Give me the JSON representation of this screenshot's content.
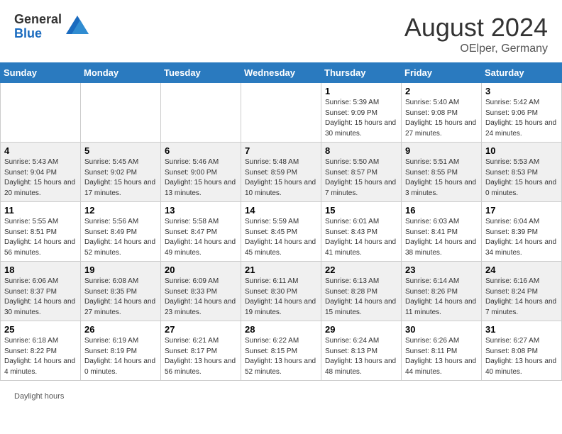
{
  "header": {
    "logo_general": "General",
    "logo_blue": "Blue",
    "month_year": "August 2024",
    "location": "OElper, Germany"
  },
  "days_of_week": [
    "Sunday",
    "Monday",
    "Tuesday",
    "Wednesday",
    "Thursday",
    "Friday",
    "Saturday"
  ],
  "weeks": [
    [
      {
        "day": "",
        "empty": true
      },
      {
        "day": "",
        "empty": true
      },
      {
        "day": "",
        "empty": true
      },
      {
        "day": "",
        "empty": true
      },
      {
        "day": "1",
        "sunrise": "5:39 AM",
        "sunset": "9:09 PM",
        "daylight": "15 hours and 30 minutes."
      },
      {
        "day": "2",
        "sunrise": "5:40 AM",
        "sunset": "9:08 PM",
        "daylight": "15 hours and 27 minutes."
      },
      {
        "day": "3",
        "sunrise": "5:42 AM",
        "sunset": "9:06 PM",
        "daylight": "15 hours and 24 minutes."
      }
    ],
    [
      {
        "day": "4",
        "sunrise": "5:43 AM",
        "sunset": "9:04 PM",
        "daylight": "15 hours and 20 minutes."
      },
      {
        "day": "5",
        "sunrise": "5:45 AM",
        "sunset": "9:02 PM",
        "daylight": "15 hours and 17 minutes."
      },
      {
        "day": "6",
        "sunrise": "5:46 AM",
        "sunset": "9:00 PM",
        "daylight": "15 hours and 13 minutes."
      },
      {
        "day": "7",
        "sunrise": "5:48 AM",
        "sunset": "8:59 PM",
        "daylight": "15 hours and 10 minutes."
      },
      {
        "day": "8",
        "sunrise": "5:50 AM",
        "sunset": "8:57 PM",
        "daylight": "15 hours and 7 minutes."
      },
      {
        "day": "9",
        "sunrise": "5:51 AM",
        "sunset": "8:55 PM",
        "daylight": "15 hours and 3 minutes."
      },
      {
        "day": "10",
        "sunrise": "5:53 AM",
        "sunset": "8:53 PM",
        "daylight": "15 hours and 0 minutes."
      }
    ],
    [
      {
        "day": "11",
        "sunrise": "5:55 AM",
        "sunset": "8:51 PM",
        "daylight": "14 hours and 56 minutes."
      },
      {
        "day": "12",
        "sunrise": "5:56 AM",
        "sunset": "8:49 PM",
        "daylight": "14 hours and 52 minutes."
      },
      {
        "day": "13",
        "sunrise": "5:58 AM",
        "sunset": "8:47 PM",
        "daylight": "14 hours and 49 minutes."
      },
      {
        "day": "14",
        "sunrise": "5:59 AM",
        "sunset": "8:45 PM",
        "daylight": "14 hours and 45 minutes."
      },
      {
        "day": "15",
        "sunrise": "6:01 AM",
        "sunset": "8:43 PM",
        "daylight": "14 hours and 41 minutes."
      },
      {
        "day": "16",
        "sunrise": "6:03 AM",
        "sunset": "8:41 PM",
        "daylight": "14 hours and 38 minutes."
      },
      {
        "day": "17",
        "sunrise": "6:04 AM",
        "sunset": "8:39 PM",
        "daylight": "14 hours and 34 minutes."
      }
    ],
    [
      {
        "day": "18",
        "sunrise": "6:06 AM",
        "sunset": "8:37 PM",
        "daylight": "14 hours and 30 minutes."
      },
      {
        "day": "19",
        "sunrise": "6:08 AM",
        "sunset": "8:35 PM",
        "daylight": "14 hours and 27 minutes."
      },
      {
        "day": "20",
        "sunrise": "6:09 AM",
        "sunset": "8:33 PM",
        "daylight": "14 hours and 23 minutes."
      },
      {
        "day": "21",
        "sunrise": "6:11 AM",
        "sunset": "8:30 PM",
        "daylight": "14 hours and 19 minutes."
      },
      {
        "day": "22",
        "sunrise": "6:13 AM",
        "sunset": "8:28 PM",
        "daylight": "14 hours and 15 minutes."
      },
      {
        "day": "23",
        "sunrise": "6:14 AM",
        "sunset": "8:26 PM",
        "daylight": "14 hours and 11 minutes."
      },
      {
        "day": "24",
        "sunrise": "6:16 AM",
        "sunset": "8:24 PM",
        "daylight": "14 hours and 7 minutes."
      }
    ],
    [
      {
        "day": "25",
        "sunrise": "6:18 AM",
        "sunset": "8:22 PM",
        "daylight": "14 hours and 4 minutes."
      },
      {
        "day": "26",
        "sunrise": "6:19 AM",
        "sunset": "8:19 PM",
        "daylight": "14 hours and 0 minutes."
      },
      {
        "day": "27",
        "sunrise": "6:21 AM",
        "sunset": "8:17 PM",
        "daylight": "13 hours and 56 minutes."
      },
      {
        "day": "28",
        "sunrise": "6:22 AM",
        "sunset": "8:15 PM",
        "daylight": "13 hours and 52 minutes."
      },
      {
        "day": "29",
        "sunrise": "6:24 AM",
        "sunset": "8:13 PM",
        "daylight": "13 hours and 48 minutes."
      },
      {
        "day": "30",
        "sunrise": "6:26 AM",
        "sunset": "8:11 PM",
        "daylight": "13 hours and 44 minutes."
      },
      {
        "day": "31",
        "sunrise": "6:27 AM",
        "sunset": "8:08 PM",
        "daylight": "13 hours and 40 minutes."
      }
    ]
  ],
  "footer": {
    "daylight_label": "Daylight hours"
  }
}
